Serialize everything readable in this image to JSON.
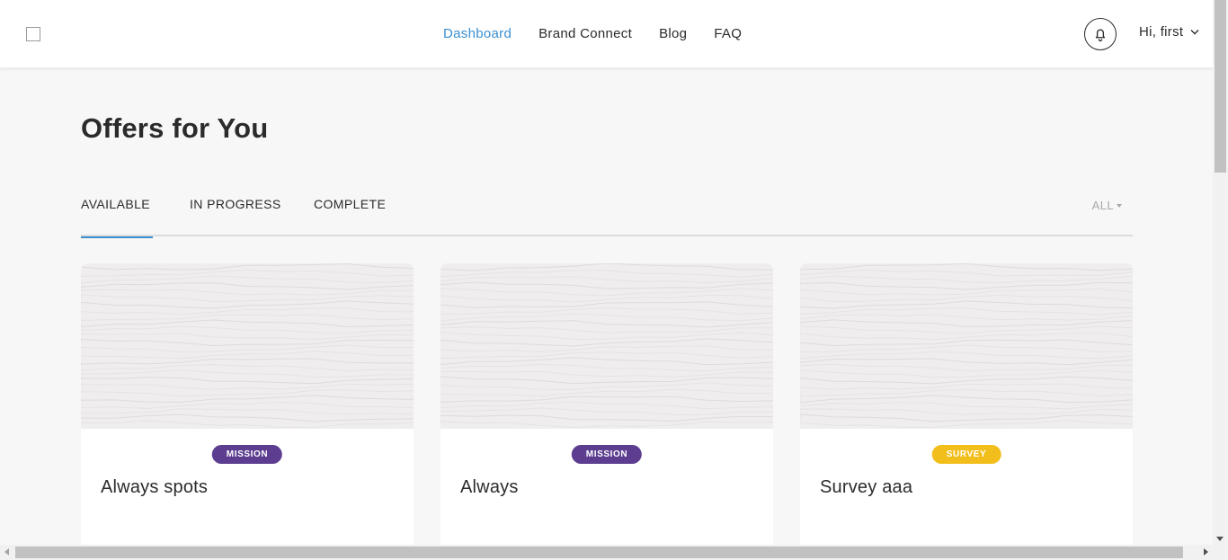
{
  "header": {
    "logo_icon": "square-logo-icon",
    "nav": [
      {
        "label": "Dashboard",
        "active": true
      },
      {
        "label": "Brand Connect",
        "active": false
      },
      {
        "label": "Blog",
        "active": false
      },
      {
        "label": "FAQ",
        "active": false
      }
    ],
    "notification_icon": "bell-icon",
    "greeting": "Hi, first",
    "user_menu_icon": "chevron-down-icon"
  },
  "page": {
    "title": "Offers for You"
  },
  "tabs": [
    {
      "label": "AVAILABLE",
      "active": true
    },
    {
      "label": "IN PROGRESS",
      "active": false
    },
    {
      "label": "COMPLETE",
      "active": false
    }
  ],
  "filter": {
    "label": "ALL",
    "icon": "caret-down-icon"
  },
  "cards": [
    {
      "badge": "MISSION",
      "badge_color": "#5c3d8f",
      "title": "Always spots"
    },
    {
      "badge": "MISSION",
      "badge_color": "#5c3d8f",
      "title": "Always"
    },
    {
      "badge": "SURVEY",
      "badge_color": "#f2be1c",
      "title": "Survey aaa"
    }
  ],
  "colors": {
    "accent": "#3a8fd0",
    "background": "#f7f7f7",
    "text": "#2b2b2b"
  }
}
